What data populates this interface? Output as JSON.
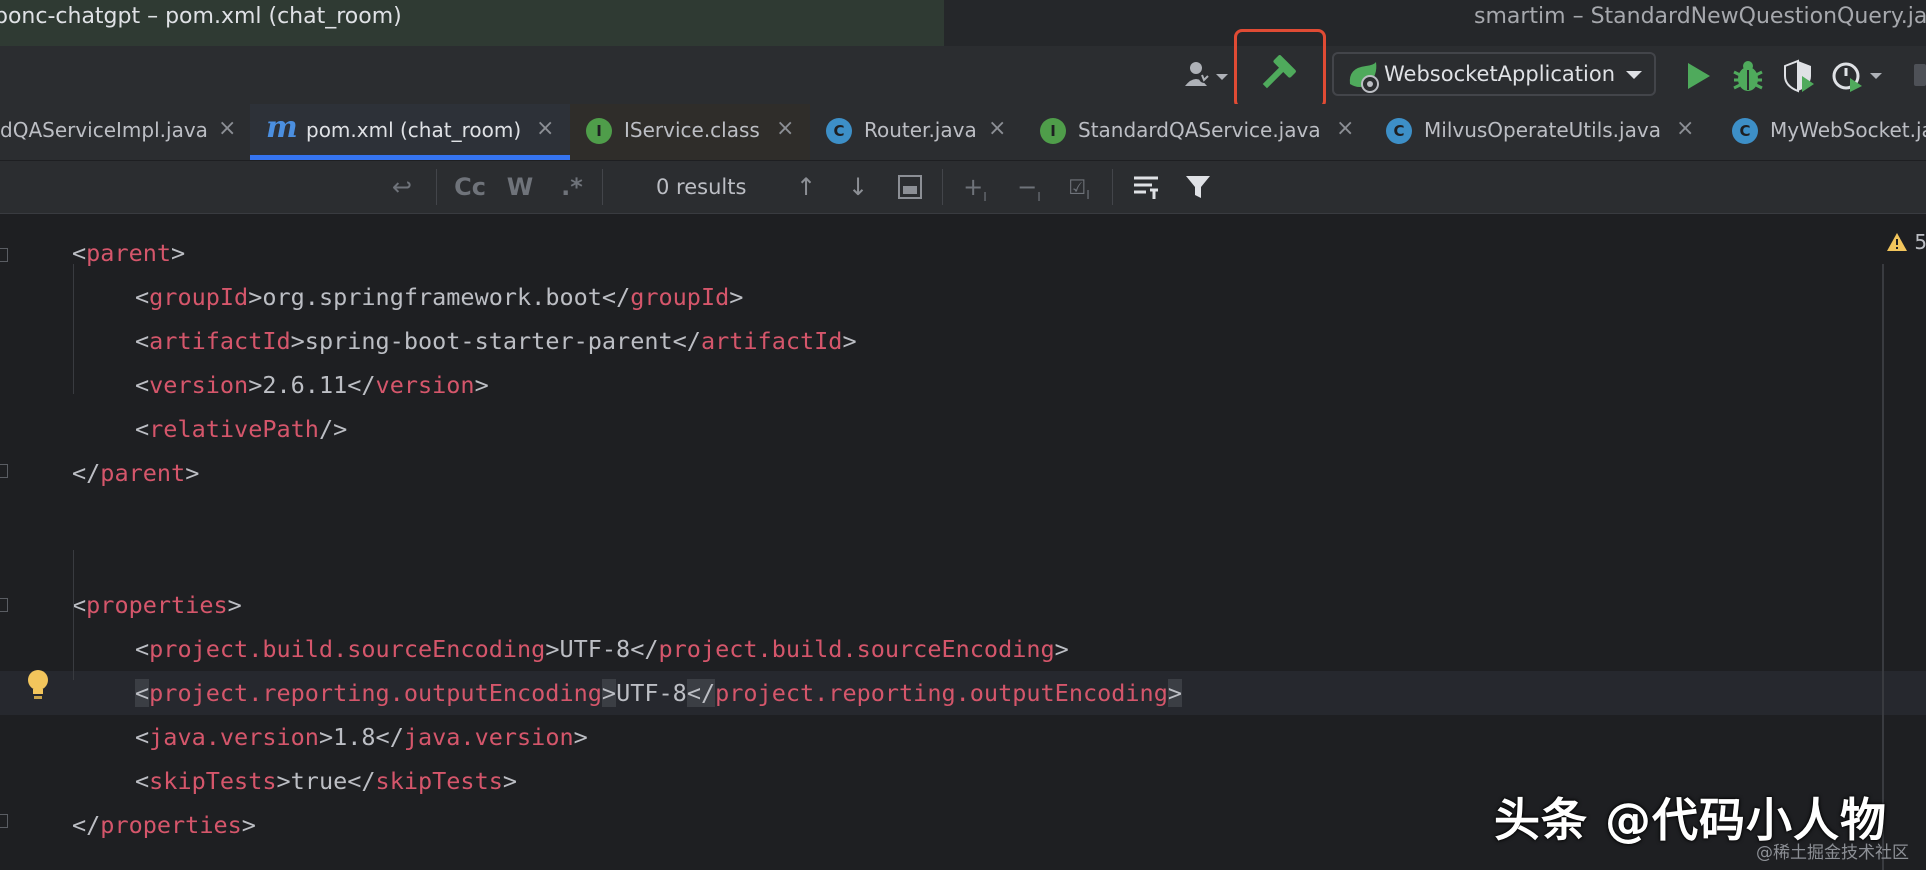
{
  "window": {
    "left_title": "ponc-chatgpt – pom.xml (chat_room)",
    "right_title": "smartim – StandardNewQuestionQuery.java"
  },
  "toolbar": {
    "user_icon": "user-dropdown-icon",
    "build_icon": "hammer-icon",
    "build_highlight_color": "#e04b34",
    "run_config_label": "WebsocketApplication",
    "run_config_icon": "spring-boot-icon",
    "run_icon": "run-icon",
    "debug_icon": "bug-icon",
    "coverage_icon": "shield-icon",
    "profile_icon": "profile-icon",
    "run_color": "#4faa5c"
  },
  "tabs": [
    {
      "label": "dQAServiceImpl.java",
      "icon": "",
      "active": false
    },
    {
      "label": "pom.xml (chat_room)",
      "icon": "m",
      "active": true
    },
    {
      "label": "IService.class",
      "icon": "I",
      "active": false
    },
    {
      "label": "Router.java",
      "icon": "C",
      "active": false
    },
    {
      "label": "StandardQAService.java",
      "icon": "I",
      "active": false
    },
    {
      "label": "MilvusOperateUtils.java",
      "icon": "C",
      "active": false
    },
    {
      "label": "MyWebSocket.ja",
      "icon": "C",
      "active": false
    }
  ],
  "search": {
    "results": "0 results",
    "match_case": "Cc",
    "words": "W",
    "regex": ".*"
  },
  "editor": {
    "warning_count": "5",
    "lines": [
      {
        "indent": 0,
        "open": "parent",
        "close": null,
        "text": null
      },
      {
        "indent": 1,
        "open": "groupId",
        "text": "org.springframework.boot",
        "close": "groupId"
      },
      {
        "indent": 1,
        "open": "artifactId",
        "text": "spring-boot-starter-parent",
        "close": "artifactId"
      },
      {
        "indent": 1,
        "open": "version",
        "text": "2.6.11",
        "close": "version"
      },
      {
        "indent": 1,
        "selfclose": "relativePath"
      },
      {
        "indent": 0,
        "closeonly": "parent"
      },
      {
        "blank": true
      },
      {
        "blank": true
      },
      {
        "indent": 0,
        "open": "properties",
        "close": null,
        "text": null
      },
      {
        "indent": 1,
        "open": "project.build.sourceEncoding",
        "text": "UTF-8",
        "close": "project.build.sourceEncoding"
      },
      {
        "indent": 1,
        "open": "project.reporting.outputEncoding",
        "text": "UTF-8",
        "close": "project.reporting.outputEncoding",
        "highlight": true
      },
      {
        "indent": 1,
        "open": "java.version",
        "text": "1.8",
        "close": "java.version"
      },
      {
        "indent": 1,
        "open": "skipTests",
        "text": "true",
        "close": "skipTests"
      },
      {
        "indent": 0,
        "closeonly": "properties"
      }
    ]
  },
  "watermark": {
    "main": "头条 @代码小人物",
    "sub": "@稀土掘金技术社区"
  }
}
